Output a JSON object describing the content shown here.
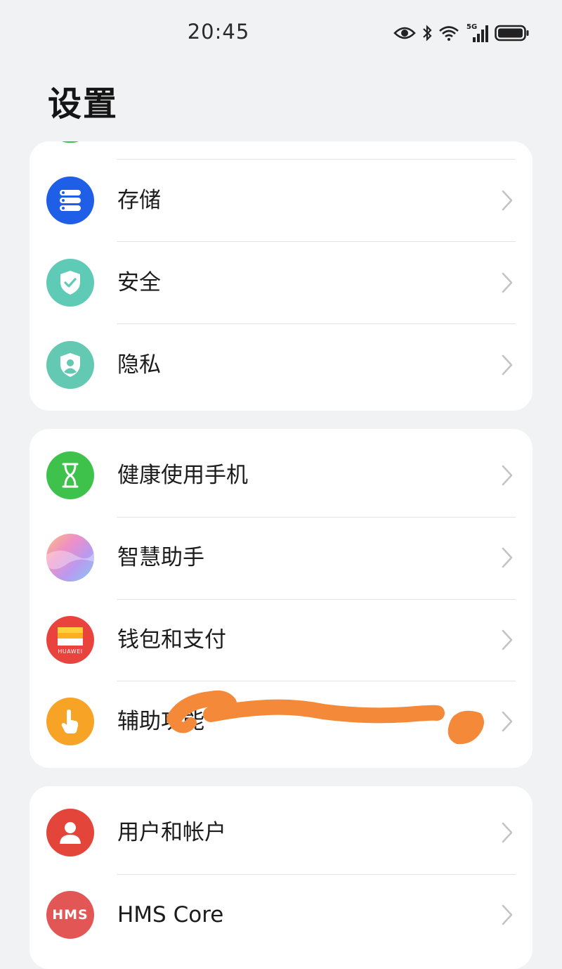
{
  "status_bar": {
    "time": "20:45",
    "network": "5G",
    "icons": [
      "eye-icon",
      "bluetooth-icon",
      "wifi-icon",
      "cellular-signal-icon",
      "battery-icon"
    ]
  },
  "title": "设置",
  "groups": [
    {
      "items": [
        {
          "label": "存储",
          "icon": "storage-icon",
          "color": "#1f5fe8"
        },
        {
          "label": "安全",
          "icon": "security-shield-icon",
          "color": "#5fcbb6"
        },
        {
          "label": "隐私",
          "icon": "privacy-shield-icon",
          "color": "#63c9b3"
        }
      ]
    },
    {
      "items": [
        {
          "label": "健康使用手机",
          "icon": "hourglass-icon",
          "color": "#3ec24b"
        },
        {
          "label": "智慧助手",
          "icon": "assistant-orb-icon",
          "color": "#e8a4d8"
        },
        {
          "label": "钱包和支付",
          "icon": "wallet-icon",
          "color": "#e8443d",
          "badge": "HUAWEI"
        },
        {
          "label": "辅助功能",
          "icon": "accessibility-hand-icon",
          "color": "#f7a325"
        }
      ]
    },
    {
      "items": [
        {
          "label": "用户和帐户",
          "icon": "user-icon",
          "color": "#e4453b"
        },
        {
          "label": "HMS Core",
          "icon": "hms-core-icon",
          "color": "#e25656",
          "badge": "HMS"
        }
      ]
    }
  ]
}
